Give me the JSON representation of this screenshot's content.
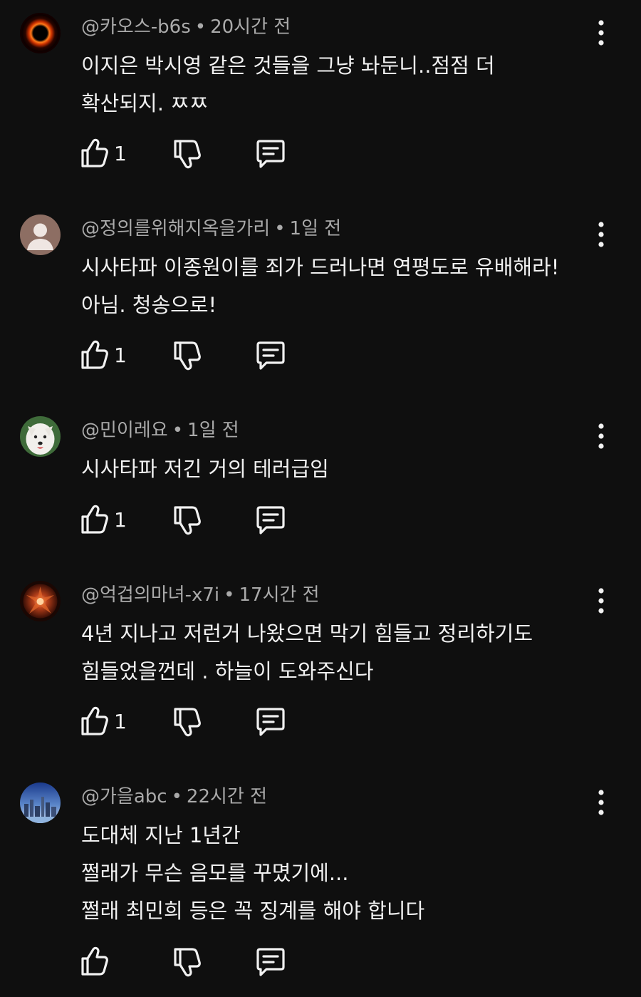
{
  "comments": [
    {
      "author": "@카오스-b6s",
      "sep": "•",
      "time": "20시간 전",
      "lines": [
        "이지은 박시영 같은 것들을 그냥 놔둔니..점점 더",
        "확산되지. ㅉㅉ"
      ],
      "likes": "1",
      "avatar": "black-hole"
    },
    {
      "author": "@정의를위해지옥을가리",
      "sep": "•",
      "time": "1일 전",
      "lines": [
        "시사타파 이종원이를 죄가 드러나면 연평도로 유배해라!",
        "아님. 청송으로!"
      ],
      "likes": "1",
      "avatar": "default-person"
    },
    {
      "author": "@민이레요",
      "sep": "•",
      "time": "1일 전",
      "lines": [
        "시사타파 저긴 거의 테러급임"
      ],
      "likes": "1",
      "avatar": "white-dog"
    },
    {
      "author": "@억겁의마녀-x7i",
      "sep": "•",
      "time": "17시간 전",
      "lines": [
        "4년 지나고 저런거 나왔으면 막기 힘들고 정리하기도",
        "힘들었을껀데 . 하늘이 도와주신다"
      ],
      "likes": "1",
      "avatar": "red-flower"
    },
    {
      "author": "@가을abc",
      "sep": "•",
      "time": "22시간 전",
      "lines": [
        "도대체 지난 1년간",
        "쩔래가 무슨 음모를 꾸몄기에...",
        "쩔래 최민희 등은 꼭 징계를 해야 합니다"
      ],
      "likes": "",
      "avatar": "city-skyline"
    }
  ],
  "icons": {
    "like": "thumbs-up-icon",
    "dislike": "thumbs-down-icon",
    "reply": "reply-comment-icon",
    "more": "more-vertical-icon"
  },
  "colors": {
    "background": "#0f0f0f",
    "text": "#f1f1f1",
    "meta": "#aaaaaa"
  }
}
